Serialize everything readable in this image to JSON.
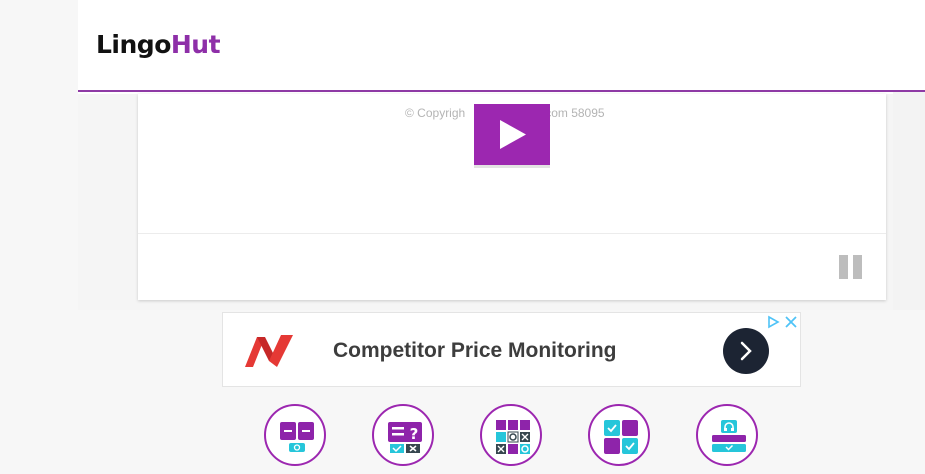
{
  "header": {
    "logo_part1": "Lingo",
    "logo_part2": "Hut"
  },
  "player": {
    "copyright_left": "© Copyrigh",
    "copyright_right": "com 58095",
    "play_icon": "play-icon",
    "pause_icon": "pause-icon"
  },
  "ad": {
    "text": "Competitor Price Monitoring",
    "icons": [
      "brand-logo-icon",
      "chevron-right-icon",
      "ad-choices-icon",
      "close-icon"
    ]
  },
  "games": [
    {
      "icon": "flashcards-game-icon"
    },
    {
      "icon": "quiz-game-icon"
    },
    {
      "icon": "tic-tac-toe-game-icon"
    },
    {
      "icon": "memory-game-icon"
    },
    {
      "icon": "listening-game-icon"
    }
  ],
  "colors": {
    "accent": "#9c27b0",
    "teal": "#26c6da",
    "dark": "#111111"
  }
}
